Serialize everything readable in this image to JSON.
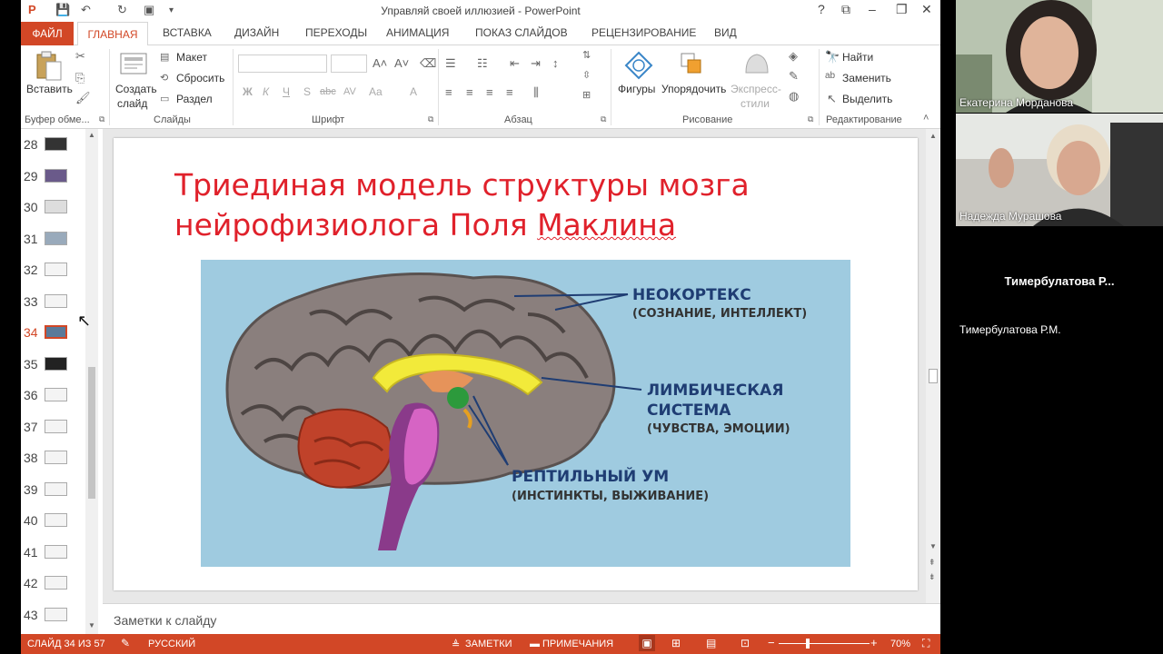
{
  "window": {
    "title": "Управляй своей иллюзией - PowerPoint"
  },
  "tabs": {
    "file": "ФАЙЛ",
    "home": "ГЛАВНАЯ",
    "items": [
      "ВСТАВКА",
      "ДИЗАЙН",
      "ПЕРЕХОДЫ",
      "АНИМАЦИЯ",
      "ПОКАЗ СЛАЙДОВ",
      "РЕЦЕНЗИРОВАНИЕ",
      "ВИД"
    ]
  },
  "ribbon": {
    "clipboard": {
      "paste": "Вставить",
      "label": "Буфер обме..."
    },
    "slides": {
      "create_line1": "Создать",
      "create_line2": "слайд",
      "layout": "Макет",
      "reset": "Сбросить",
      "section": "Раздел",
      "label": "Слайды"
    },
    "font": {
      "label": "Шрифт",
      "bold": "Ж",
      "italic": "К",
      "underline": "Ч",
      "shadow": "S",
      "strike": "abc",
      "spacing": "AV",
      "case": "Aa",
      "color": "A"
    },
    "paragraph": {
      "label": "Абзац"
    },
    "drawing": {
      "shapes": "Фигуры",
      "arrange": "Упорядочить",
      "styles_line1": "Экспресс-",
      "styles_line2": "стили",
      "label": "Рисование"
    },
    "editing": {
      "find": "Найти",
      "replace": "Заменить",
      "select": "Выделить",
      "label": "Редактирование"
    }
  },
  "thumbnails": {
    "numbers": [
      "28",
      "29",
      "30",
      "31",
      "32",
      "33",
      "34",
      "35",
      "36",
      "37",
      "38",
      "39",
      "40",
      "41",
      "42",
      "43"
    ],
    "selected": "34"
  },
  "slide": {
    "title_line1": "Триединая модель структуры мозга",
    "title_line2_a": "нейрофизиолога Поля ",
    "title_line2_b": "Маклина",
    "neocortex": "НЕОКОРТЕКС",
    "neocortex_sub": "(СОЗНАНИЕ, ИНТЕЛЛЕКТ)",
    "limbic_1": "ЛИМБИЧЕСКАЯ",
    "limbic_2": "СИСТЕМА",
    "limbic_sub": "(ЧУВСТВА, ЭМОЦИИ)",
    "reptile": "РЕПТИЛЬНЫЙ УМ",
    "reptile_sub": "(ИНСТИНКТЫ, ВЫЖИВАНИЕ)"
  },
  "notes": {
    "placeholder": "Заметки к слайду"
  },
  "status": {
    "slide": "СЛАЙД 34 ИЗ 57",
    "language": "РУССКИЙ",
    "notes": "ЗАМЕТКИ",
    "comments": "ПРИМЕЧАНИЯ",
    "zoom": "70%"
  },
  "participants": [
    {
      "name": "Екатерина Морданова"
    },
    {
      "name": "Надежда Мурашова"
    },
    {
      "name": "Тимербулатова Р.М.",
      "center_label": "Тимербулатова Р..."
    }
  ],
  "colors": {
    "accent": "#d24726",
    "title_red": "#e0212b",
    "label_blue": "#1f3d73"
  }
}
